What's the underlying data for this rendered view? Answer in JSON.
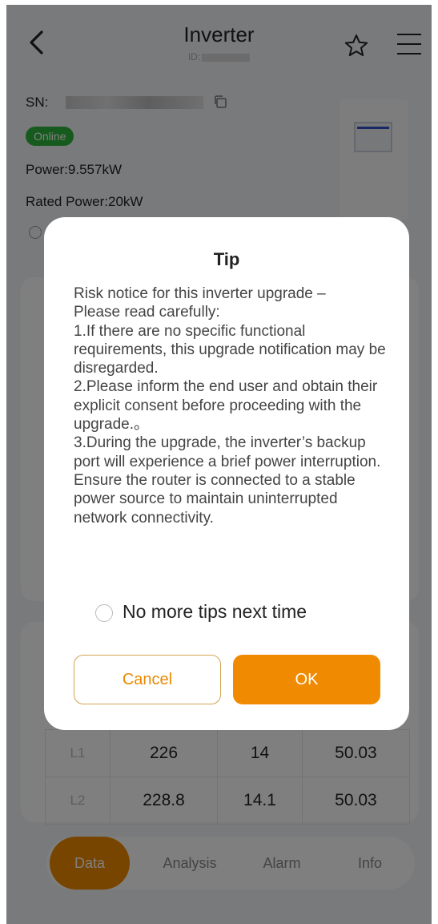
{
  "header": {
    "title": "Inverter",
    "id_label": "ID:"
  },
  "device": {
    "sn_label": "SN:",
    "status": "Online",
    "power": "Power:9.557kW",
    "rated_power": "Rated Power:20kW"
  },
  "table": {
    "rows": [
      {
        "phase": "L1",
        "voltage": "226",
        "current": "14",
        "frequency": "50.03"
      },
      {
        "phase": "L2",
        "voltage": "228.8",
        "current": "14.1",
        "frequency": "50.03"
      }
    ]
  },
  "nav": {
    "tabs": [
      "Data",
      "Analysis",
      "Alarm",
      "Info"
    ],
    "active": "Data"
  },
  "dialog": {
    "title": "Tip",
    "body": "Risk notice for this inverter upgrade –\nPlease read carefully:\n1.If there are no specific functional requirements, this upgrade notification may be disregarded.\n2.Please inform the end user and obtain their explicit consent before proceeding with the upgrade.。\n3.During the upgrade, the inverter’s backup port will experience a brief power interruption. Ensure the router is connected to a stable power source to maintain uninterrupted network connectivity.",
    "checkbox_label": "No more tips next time",
    "cancel_label": "Cancel",
    "ok_label": "OK"
  },
  "colors": {
    "accent": "#f08a00",
    "online": "#2fb53d",
    "overlay": "rgba(0,0,0,0.5)"
  }
}
